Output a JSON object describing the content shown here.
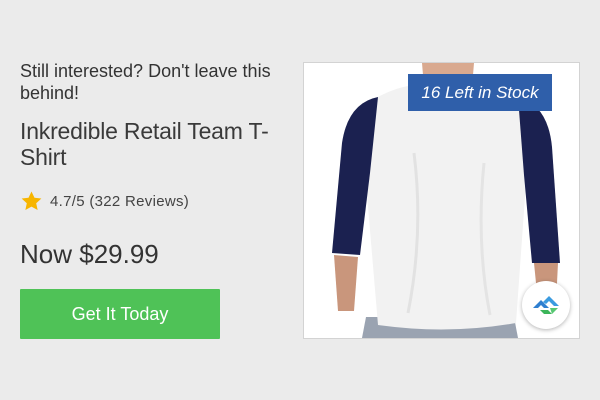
{
  "ad": {
    "tagline": "Still interested? Don't leave this behind!",
    "product_name": "Inkredible Retail Team T-Shirt",
    "rating": "4.7/5 (322 Reviews)",
    "price": "Now $29.99",
    "cta_label": "Get It Today",
    "stock_badge": "16 Left in Stock"
  },
  "icons": {
    "star": "star-icon",
    "logo": "brand-logo-icon"
  },
  "colors": {
    "background": "#ebebeb",
    "cta": "#4fc257",
    "badge": "#2f5faa",
    "star": "#f7b500",
    "shirt_sleeve": "#1b2150"
  }
}
